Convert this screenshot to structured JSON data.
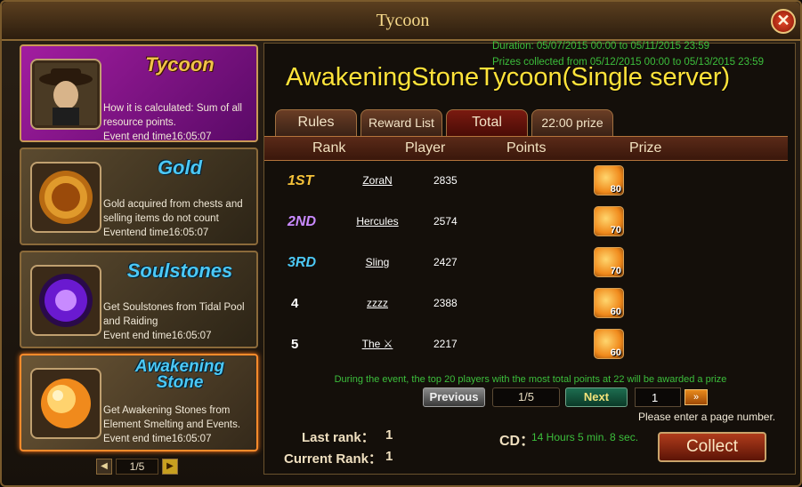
{
  "window": {
    "title": "Tycoon",
    "close_label": "✕"
  },
  "sidebar": {
    "cards": [
      {
        "title": "Tycoon",
        "desc": "How it is calculated: Sum of all resource points.",
        "end": "Event end time16:05:07"
      },
      {
        "title": "Gold",
        "desc": "Gold acquired from chests and selling items do not count",
        "end": "Eventend time16:05:07"
      },
      {
        "title": "Soulstones",
        "desc": "Get Soulstones from Tidal Pool and Raiding",
        "end": "Event end time16:05:07"
      },
      {
        "title_line1": "Awakening",
        "title_line2": "Stone",
        "desc": "Get Awakening Stones from Element Smelting and Events.",
        "end": "Event end time16:05:07"
      }
    ],
    "pager": {
      "page": "1/5",
      "prev": "◀",
      "next": "▶"
    }
  },
  "main": {
    "duration": "Duration: 05/07/2015 00:00 to 05/11/2015 23:59",
    "prizes_collected": "Prizes collected from 05/12/2015 00:00 to 05/13/2015 23:59",
    "headline": "AwakeningStoneTycoon(Single server)",
    "tabs": [
      "Rules",
      "Reward List",
      "Total",
      "22:00 prize"
    ],
    "columns": [
      "Rank",
      "Player",
      "Points",
      "Prize"
    ],
    "rows": [
      {
        "rank": "1ST",
        "player": "ZoraN",
        "points": "2835",
        "prize": "80"
      },
      {
        "rank": "2ND",
        "player": "Hercules",
        "points": "2574",
        "prize": "70"
      },
      {
        "rank": "3RD",
        "player": "Sling",
        "points": "2427",
        "prize": "70"
      },
      {
        "rank": "4",
        "player": "zzzz",
        "points": "2388",
        "prize": "60"
      },
      {
        "rank": "5",
        "player": "The ⚔",
        "points": "2217",
        "prize": "60"
      }
    ],
    "notice": "During the event, the top 20 players with the most total points at 22 will be awarded a prize",
    "pagination": {
      "previous": "Previous",
      "page": "1/5",
      "next": "Next",
      "input_value": "1",
      "go": "»",
      "hint": "Please enter a page number."
    },
    "last_rank_label": "Last rank：",
    "last_rank_value": "1",
    "current_rank_label": "Current Rank：",
    "current_rank_value": "1",
    "cd_label": "CD：",
    "cd_value": "14 Hours 5 min. 8 sec.",
    "collect": "Collect"
  },
  "colors": {
    "accent_gold": "#ffe33a",
    "green_text": "#3cbf3c",
    "rank1": "#f5c23a",
    "rank2": "#c98aff",
    "rank3": "#4cc8f5"
  }
}
